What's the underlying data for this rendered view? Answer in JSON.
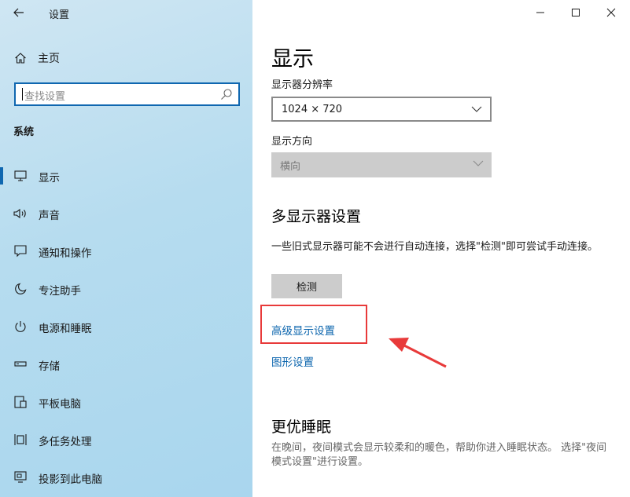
{
  "window": {
    "title": "设置"
  },
  "sidebar": {
    "home_label": "主页",
    "search_placeholder": "查找设置",
    "section_label": "系统",
    "items": [
      {
        "label": "显示",
        "icon": "monitor-icon",
        "active": true
      },
      {
        "label": "声音",
        "icon": "speaker-icon"
      },
      {
        "label": "通知和操作",
        "icon": "notification-icon"
      },
      {
        "label": "专注助手",
        "icon": "moon-icon"
      },
      {
        "label": "电源和睡眠",
        "icon": "power-icon"
      },
      {
        "label": "存储",
        "icon": "storage-icon"
      },
      {
        "label": "平板电脑",
        "icon": "tablet-icon"
      },
      {
        "label": "多任务处理",
        "icon": "multitask-icon"
      },
      {
        "label": "投影到此电脑",
        "icon": "project-icon"
      }
    ]
  },
  "main": {
    "title": "显示",
    "resolution": {
      "label": "显示器分辨率",
      "value": "1024 × 720"
    },
    "orientation": {
      "label": "显示方向",
      "value": "横向",
      "disabled": true
    },
    "multi": {
      "title": "多显示器设置",
      "description": "一些旧式显示器可能不会进行自动连接，选择\"检测\"即可尝试手动连接。",
      "detect_button": "检测",
      "advanced_link": "高级显示设置",
      "graphics_link": "图形设置"
    },
    "sleep": {
      "title": "更优睡眠",
      "description": "在晚间，夜间模式会显示较柔和的暖色，帮助你进入睡眠状态。 选择\"夜间模式设置\"进行设置。"
    }
  },
  "colors": {
    "accent": "#0f67b0",
    "link": "#0a64ad",
    "annotation": "#e83a3a"
  }
}
